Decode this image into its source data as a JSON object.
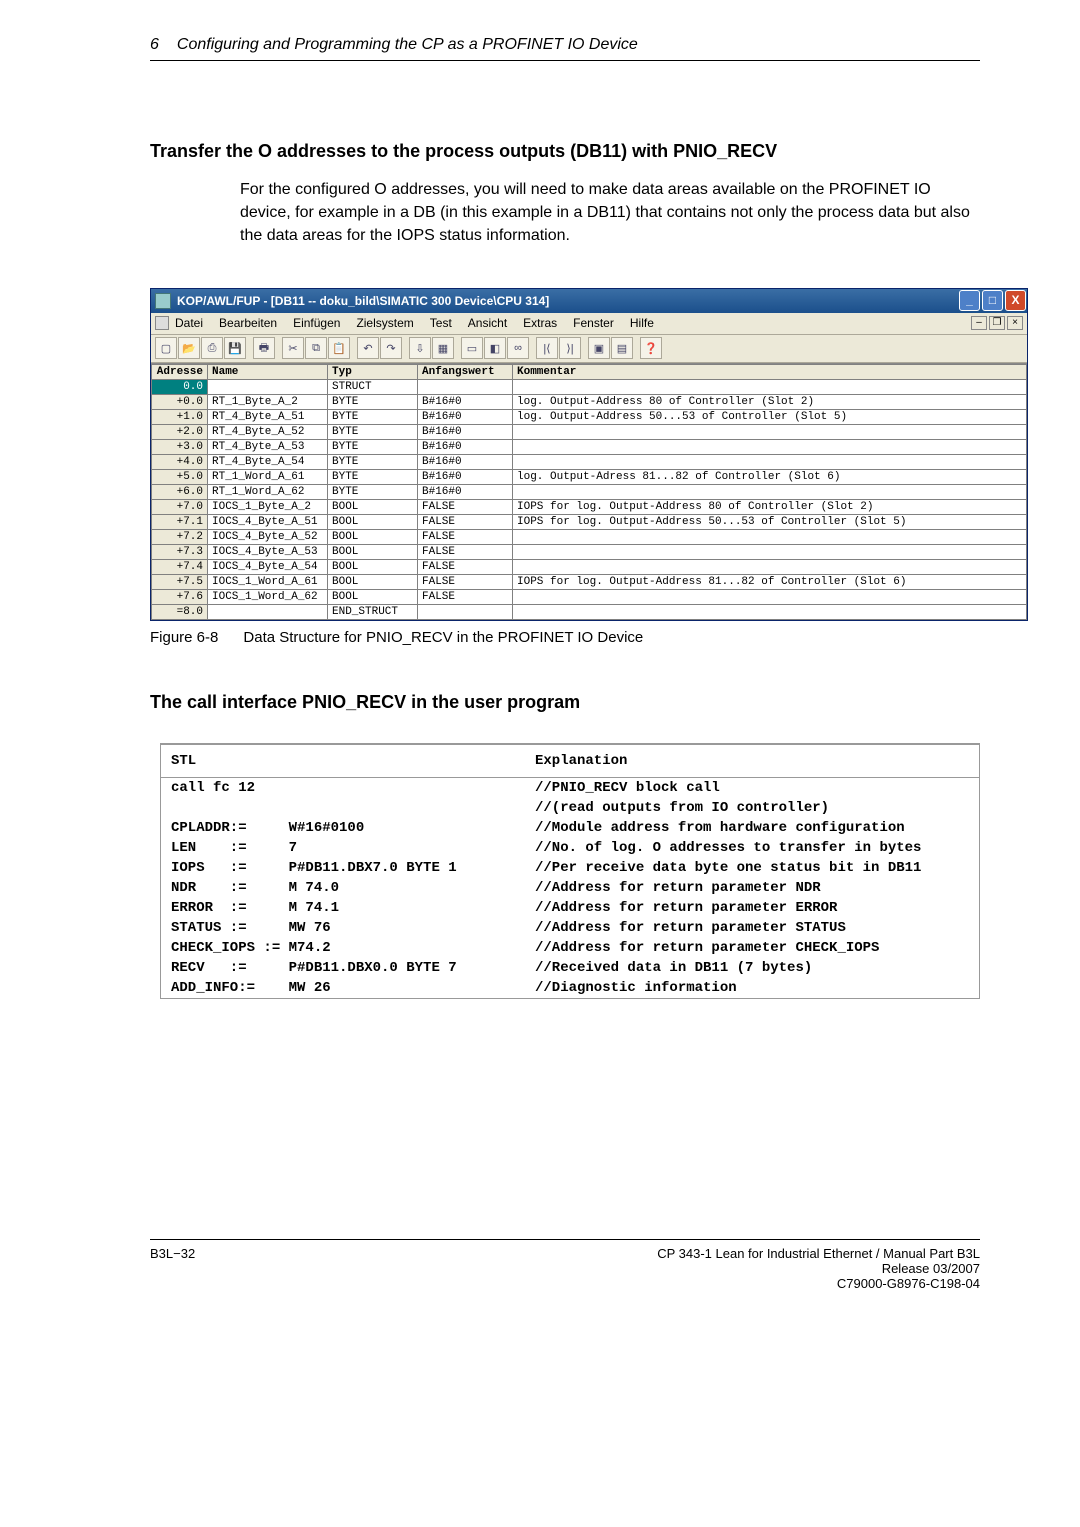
{
  "running_head": {
    "chapter": "6",
    "title": "Configuring and Programming the CP as a PROFINET IO Device"
  },
  "section1": {
    "heading": "Transfer the O addresses to the process outputs (DB11) with PNIO_RECV",
    "paragraph": "For the configured O addresses, you will need to make data areas available on the PROFINET IO device, for example in a DB (in this example in a DB11) that contains not only the process data but also the data areas for the IOPS status information."
  },
  "editor": {
    "title": "KOP/AWL/FUP  - [DB11 -- doku_bild\\SIMATIC 300 Device\\CPU 314]",
    "menus": [
      "Datei",
      "Bearbeiten",
      "Einfügen",
      "Zielsystem",
      "Test",
      "Ansicht",
      "Extras",
      "Fenster",
      "Hilfe"
    ],
    "headers": [
      "Adresse",
      "Name",
      "Typ",
      "Anfangswert",
      "Kommentar"
    ],
    "rows": [
      {
        "addr": "0.0",
        "sel": true,
        "name": "",
        "typ": "STRUCT",
        "anf": "",
        "komm": ""
      },
      {
        "addr": "+0.0",
        "name": "RT_1_Byte_A_2",
        "typ": "BYTE",
        "anf": "B#16#0",
        "komm": "log. Output-Address 80 of Controller (Slot 2)"
      },
      {
        "addr": "+1.0",
        "name": "RT_4_Byte_A_51",
        "typ": "BYTE",
        "anf": "B#16#0",
        "komm": "log. Output-Address 50...53 of Controller (Slot 5)"
      },
      {
        "addr": "+2.0",
        "name": "RT_4_Byte_A_52",
        "typ": "BYTE",
        "anf": "B#16#0",
        "komm": ""
      },
      {
        "addr": "+3.0",
        "name": "RT_4_Byte_A_53",
        "typ": "BYTE",
        "anf": "B#16#0",
        "komm": ""
      },
      {
        "addr": "+4.0",
        "name": "RT_4_Byte_A_54",
        "typ": "BYTE",
        "anf": "B#16#0",
        "komm": ""
      },
      {
        "addr": "+5.0",
        "name": "RT_1_Word_A_61",
        "typ": "BYTE",
        "anf": "B#16#0",
        "komm": "log. Output-Adress 81...82 of Controller (Slot 6)"
      },
      {
        "addr": "+6.0",
        "name": "RT_1_Word_A_62",
        "typ": "BYTE",
        "anf": "B#16#0",
        "komm": ""
      },
      {
        "addr": "+7.0",
        "name": "IOCS_1_Byte_A_2",
        "typ": "BOOL",
        "anf": "FALSE",
        "komm": "IOPS for log. Output-Address 80 of Controller (Slot 2)"
      },
      {
        "addr": "+7.1",
        "name": "IOCS_4_Byte_A_51",
        "typ": "BOOL",
        "anf": "FALSE",
        "komm": "IOPS for log. Output-Address 50...53 of Controller (Slot 5)"
      },
      {
        "addr": "+7.2",
        "name": "IOCS_4_Byte_A_52",
        "typ": "BOOL",
        "anf": "FALSE",
        "komm": ""
      },
      {
        "addr": "+7.3",
        "name": "IOCS_4_Byte_A_53",
        "typ": "BOOL",
        "anf": "FALSE",
        "komm": ""
      },
      {
        "addr": "+7.4",
        "name": "IOCS_4_Byte_A_54",
        "typ": "BOOL",
        "anf": "FALSE",
        "komm": ""
      },
      {
        "addr": "+7.5",
        "name": "IOCS_1_Word_A_61",
        "typ": "BOOL",
        "anf": "FALSE",
        "komm": "IOPS for log. Output-Address 81...82 of Controller (Slot 6)"
      },
      {
        "addr": "+7.6",
        "name": "IOCS_1_Word_A_62",
        "typ": "BOOL",
        "anf": "FALSE",
        "komm": ""
      },
      {
        "addr": "=8.0",
        "name": "",
        "typ": "END_STRUCT",
        "anf": "",
        "komm": ""
      }
    ]
  },
  "figure_caption": {
    "label": "Figure 6-8",
    "text": "Data Structure for PNIO_RECV in the PROFINET IO Device"
  },
  "section2": {
    "heading": "The call interface PNIO_RECV in the user program"
  },
  "stl": {
    "head_left": "STL",
    "head_right": "Explanation",
    "rows": [
      {
        "l": "call fc 12",
        "r": "//PNIO_RECV block call"
      },
      {
        "l": "",
        "r": "//(read outputs from IO controller)"
      },
      {
        "l": "CPLADDR:=     W#16#0100",
        "r": "//Module address from hardware configuration"
      },
      {
        "l": "LEN    :=     7",
        "r": "//No. of log. O addresses to transfer in bytes"
      },
      {
        "l": "IOPS   :=     P#DB11.DBX7.0 BYTE 1",
        "r": "//Per receive data byte one status bit in DB11"
      },
      {
        "l": "NDR    :=     M 74.0",
        "r": "//Address for return parameter NDR"
      },
      {
        "l": "ERROR  :=     M 74.1",
        "r": "//Address for return parameter ERROR"
      },
      {
        "l": "STATUS :=     MW 76",
        "r": "//Address for return parameter STATUS"
      },
      {
        "l": "CHECK_IOPS := M74.2",
        "r": "//Address for return parameter CHECK_IOPS"
      },
      {
        "l": "RECV   :=     P#DB11.DBX0.0 BYTE 7",
        "r": "//Received data in DB11 (7 bytes)"
      },
      {
        "l": "ADD_INFO:=    MW 26",
        "r": "//Diagnostic information"
      }
    ]
  },
  "footer": {
    "left": "B3L−32",
    "right": [
      "CP 343-1 Lean for Industrial Ethernet / Manual Part B3L",
      "Release 03/2007",
      "C79000-G8976-C198-04"
    ]
  },
  "winbtn": {
    "min": "_",
    "max": "□",
    "close": "X"
  },
  "mdi": {
    "min": "–",
    "max": "❐",
    "close": "×"
  }
}
